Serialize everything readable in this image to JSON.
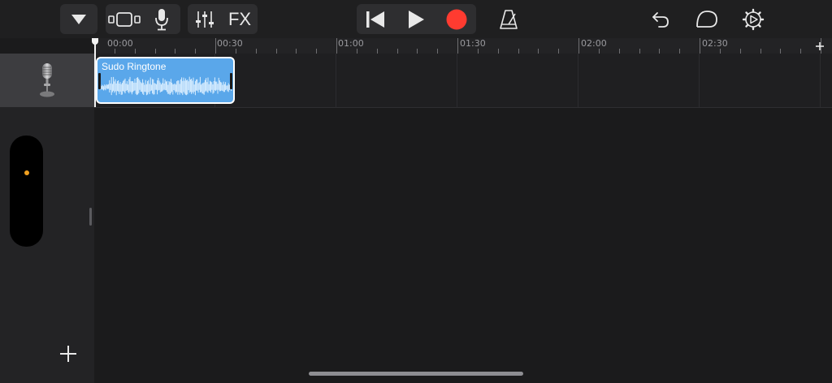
{
  "toolbar": {
    "fx_label": "FX",
    "icons": {
      "menu": "triangle-down-icon",
      "view": "tracks-view-icon",
      "instrument": "microphone-icon",
      "mixer": "sliders-icon",
      "rewind": "go-to-beginning-icon",
      "play": "play-icon",
      "record": "record-icon",
      "metronome": "metronome-icon",
      "undo": "undo-icon",
      "loop": "loop-browser-icon",
      "settings": "settings-gear-icon"
    }
  },
  "ruler": {
    "labels": [
      "00:00",
      "00:30",
      "01:00",
      "01:30",
      "02:00",
      "02:30"
    ],
    "add_marker": "+"
  },
  "track": {
    "instrument_icon": "microphone-icon",
    "region_name": "Sudo Ringtone"
  },
  "sidebar": {
    "add_track": "+"
  },
  "colors": {
    "record": "#ff3b30",
    "region": "#5aa7ea",
    "level_dot": "#f0a020"
  }
}
